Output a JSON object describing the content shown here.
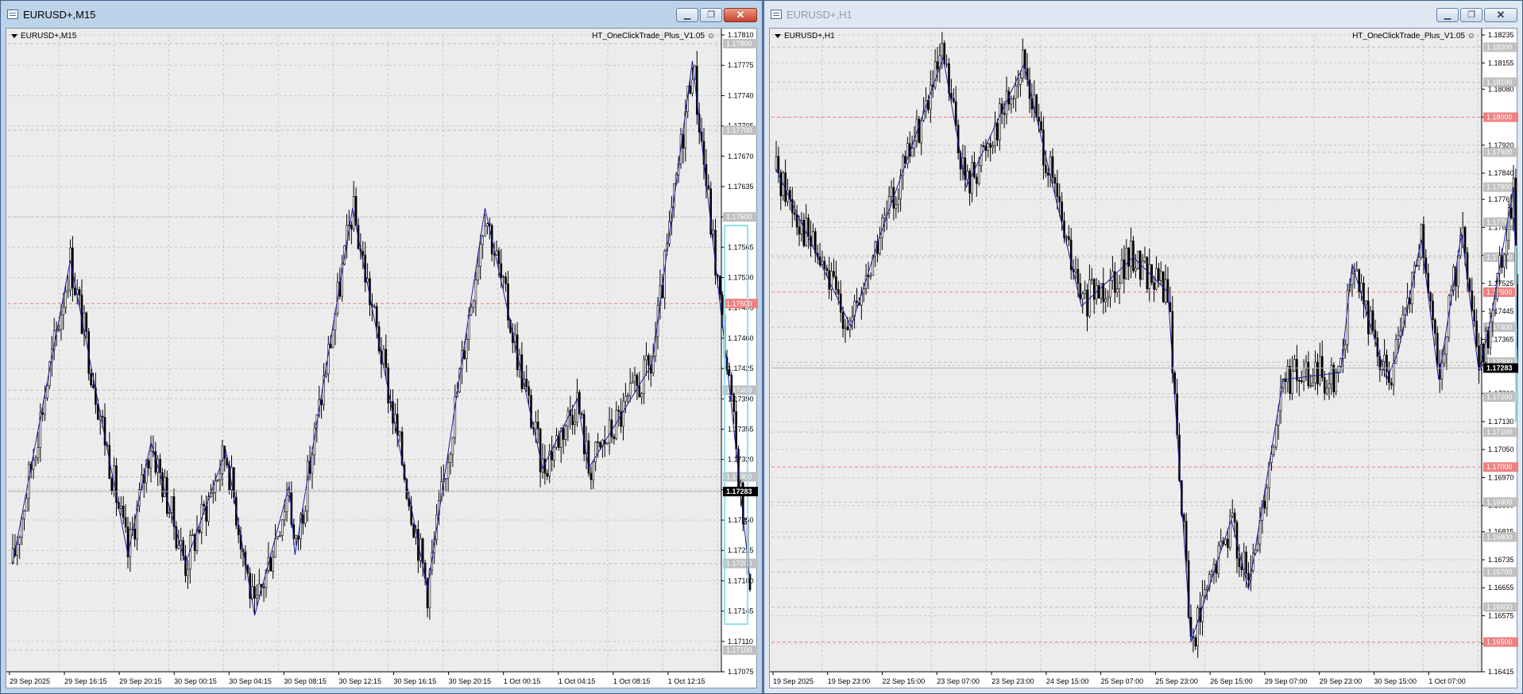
{
  "left": {
    "title": "EURUSD+,M15",
    "symbol": "EURUSD+,M15",
    "indicator": "HT_OneClickTrade_Plus_V1.05 ☺",
    "price_top": 1.1781,
    "price_bottom": 1.17075,
    "price_labels": [
      "1.17810",
      "1.17775",
      "1.17740",
      "1.17705",
      "1.17670",
      "1.17635",
      "1.17600",
      "1.17565",
      "1.17530",
      "1.17495",
      "1.17460",
      "1.17425",
      "1.17390",
      "1.17355",
      "1.17320",
      "1.17285",
      "1.17250",
      "1.17215",
      "1.17180",
      "1.17145",
      "1.17110",
      "1.17075"
    ],
    "level_lines": [
      {
        "price": 1.178,
        "text": "1.17800",
        "color": "#c0c0c0"
      },
      {
        "price": 1.177,
        "text": "1.17700",
        "color": "#c0c0c0"
      },
      {
        "price": 1.176,
        "text": "1.17600",
        "color": "#c0c0c0"
      },
      {
        "price": 1.175,
        "text": "1.17500",
        "color": "#f08080"
      },
      {
        "price": 1.174,
        "text": "1.17400",
        "color": "#c0c0c0"
      },
      {
        "price": 1.173,
        "text": "1.17300",
        "color": "#c0c0c0"
      },
      {
        "price": 1.172,
        "text": "1.17200",
        "color": "#c0c0c0"
      },
      {
        "price": 1.171,
        "text": "1.17100",
        "color": "#c0c0c0"
      }
    ],
    "current_price": 1.17283,
    "current_price_text": "1.17283",
    "time_labels": [
      "29 Sep 2025",
      "29 Sep 16:15",
      "29 Sep 20:15",
      "30 Sep 00:15",
      "30 Sep 04:15",
      "30 Sep 08:15",
      "30 Sep 12:15",
      "30 Sep 16:15",
      "30 Sep 20:15",
      "1 Oct 00:15",
      "1 Oct 04:15",
      "1 Oct 08:15",
      "1 Oct 12:15"
    ],
    "zigzag": [
      [
        0,
        1.172
      ],
      [
        50,
        1.1755
      ],
      [
        100,
        1.1721
      ],
      [
        120,
        1.1734
      ],
      [
        150,
        1.172
      ],
      [
        185,
        1.1733
      ],
      [
        210,
        1.1714
      ],
      [
        240,
        1.1729
      ],
      [
        245,
        1.1721
      ],
      [
        295,
        1.1761
      ],
      [
        360,
        1.1717
      ],
      [
        410,
        1.1761
      ],
      [
        460,
        1.1731
      ],
      [
        490,
        1.1739
      ],
      [
        500,
        1.1731
      ],
      [
        555,
        1.1743
      ],
      [
        590,
        1.1778
      ],
      [
        620,
        1.1743
      ],
      [
        640,
        1.1718
      ]
    ],
    "box": {
      "start": 618,
      "end": 638,
      "high": 1.1759,
      "low": 1.1713
    }
  },
  "right": {
    "title": "EURUSD+,H1",
    "symbol": "EURUSD+,H1",
    "indicator": "HT_OneClickTrade_Plus_V1.05 ☺",
    "price_top": 1.18235,
    "price_bottom": 1.16415,
    "price_labels": [
      "1.18235",
      "1.18155",
      "1.18080",
      "1.18000",
      "1.17920",
      "1.17840",
      "1.17765",
      "1.17685",
      "1.17605",
      "1.17525",
      "1.17445",
      "1.17365",
      "1.17290",
      "1.17210",
      "1.17130",
      "1.17050",
      "1.16970",
      "1.16890",
      "1.16815",
      "1.16735",
      "1.16655",
      "1.16575",
      "1.16495",
      "1.16415"
    ],
    "level_lines": [
      {
        "price": 1.182,
        "text": "1.18200",
        "color": "#c0c0c0"
      },
      {
        "price": 1.181,
        "text": "1.18100",
        "color": "#c0c0c0"
      },
      {
        "price": 1.18,
        "text": "1.18000",
        "color": "#f08080"
      },
      {
        "price": 1.179,
        "text": "1.17900",
        "color": "#c0c0c0"
      },
      {
        "price": 1.178,
        "text": "1.17800",
        "color": "#c0c0c0"
      },
      {
        "price": 1.177,
        "text": "1.17700",
        "color": "#c0c0c0"
      },
      {
        "price": 1.176,
        "text": "1.17600",
        "color": "#c0c0c0"
      },
      {
        "price": 1.175,
        "text": "1.17500",
        "color": "#f08080"
      },
      {
        "price": 1.174,
        "text": "1.17400",
        "color": "#c0c0c0"
      },
      {
        "price": 1.173,
        "text": "1.17300",
        "color": "#c0c0c0"
      },
      {
        "price": 1.172,
        "text": "1.17200",
        "color": "#c0c0c0"
      },
      {
        "price": 1.171,
        "text": "1.17100",
        "color": "#c0c0c0"
      },
      {
        "price": 1.17,
        "text": "1.17000",
        "color": "#f08080"
      },
      {
        "price": 1.169,
        "text": "1.16900",
        "color": "#c0c0c0"
      },
      {
        "price": 1.168,
        "text": "1.16800",
        "color": "#c0c0c0"
      },
      {
        "price": 1.167,
        "text": "1.16700",
        "color": "#c0c0c0"
      },
      {
        "price": 1.166,
        "text": "1.16600",
        "color": "#c0c0c0"
      },
      {
        "price": 1.165,
        "text": "1.16500",
        "color": "#f08080"
      }
    ],
    "current_price": 1.17283,
    "current_price_text": "1.17283",
    "time_labels": [
      "19 Sep 2025",
      "19 Sep 23:00",
      "22 Sep 15:00",
      "23 Sep 07:00",
      "23 Sep 23:00",
      "24 Sep 15:00",
      "25 Sep 07:00",
      "25 Sep 23:00",
      "26 Sep 15:00",
      "29 Sep 07:00",
      "29 Sep 23:00",
      "30 Sep 15:00",
      "1 Oct 07:00"
    ],
    "zigzag": [
      [
        0,
        1.1785
      ],
      [
        65,
        1.174
      ],
      [
        90,
        1.1766
      ],
      [
        145,
        1.1817
      ],
      [
        165,
        1.178
      ],
      [
        215,
        1.1815
      ],
      [
        265,
        1.1746
      ],
      [
        310,
        1.176
      ],
      [
        340,
        1.175
      ],
      [
        360,
        1.165
      ],
      [
        395,
        1.1685
      ],
      [
        410,
        1.1665
      ],
      [
        440,
        1.1725
      ],
      [
        490,
        1.1727
      ],
      [
        500,
        1.1758
      ],
      [
        530,
        1.1725
      ],
      [
        540,
        1.1733
      ],
      [
        560,
        1.1765
      ],
      [
        575,
        1.1725
      ],
      [
        595,
        1.1767
      ],
      [
        610,
        1.1727
      ],
      [
        620,
        1.1742
      ],
      [
        640,
        1.178
      ],
      [
        645,
        1.172
      ]
    ],
    "box": {
      "start": 642,
      "end": 652,
      "high": 1.1763,
      "low": 1.1713
    }
  },
  "colors": {
    "candle": "#000000",
    "zigzag": "#1a1aa8",
    "box": "#8ee2e8",
    "grid": "#c8c8c8",
    "current": "#000000"
  }
}
